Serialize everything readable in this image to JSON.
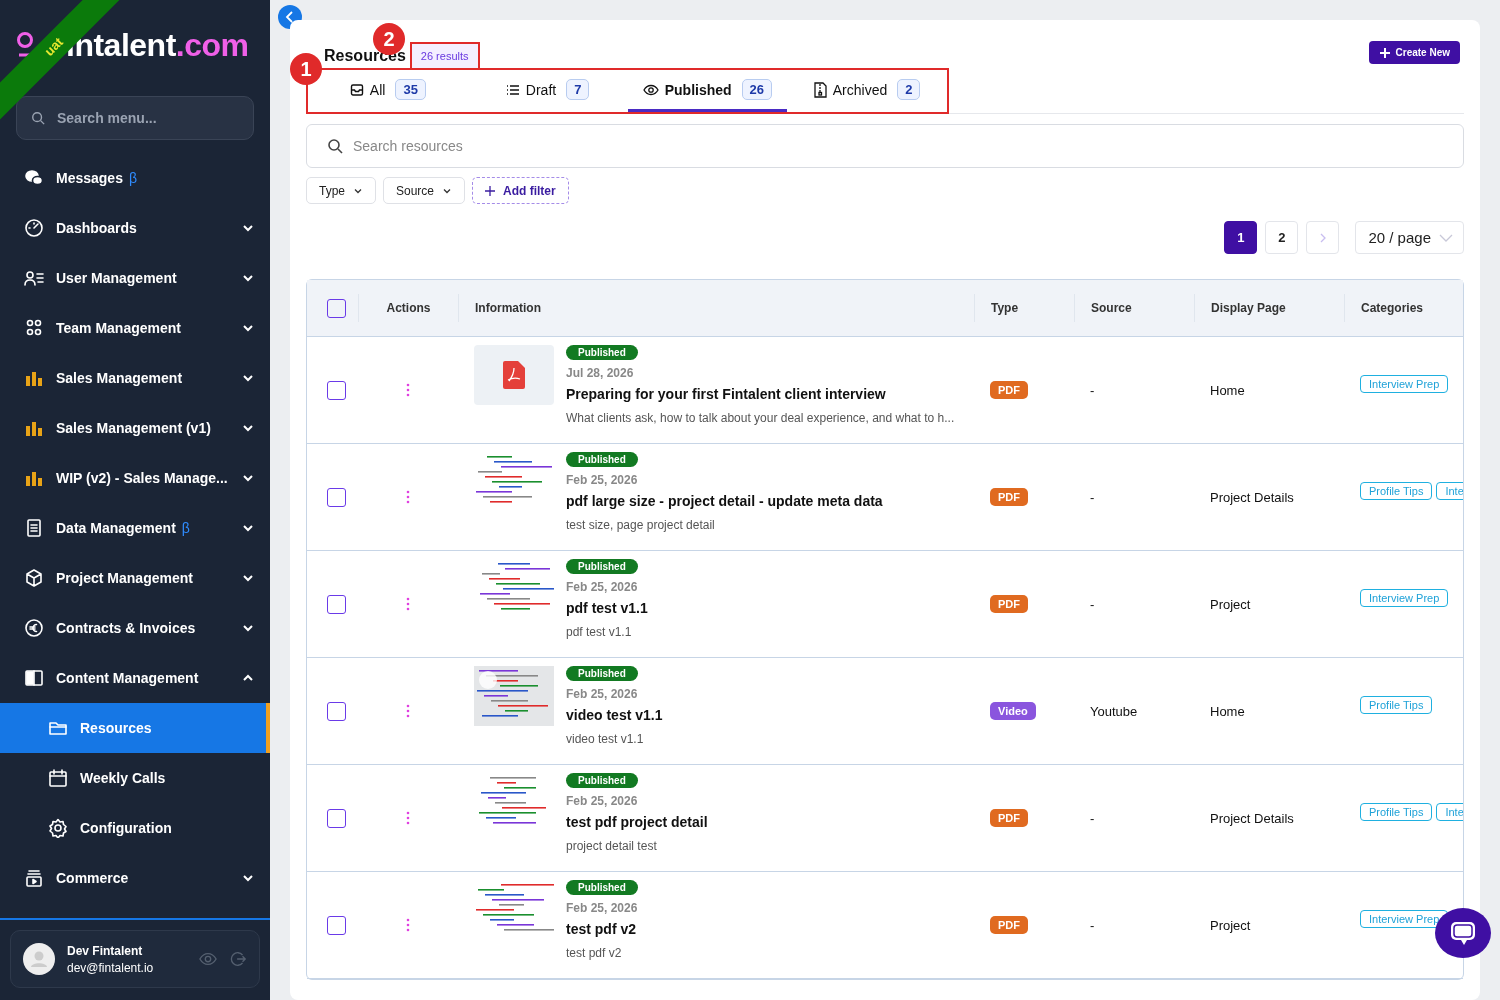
{
  "ribbon": {
    "label": "uat"
  },
  "sidebar": {
    "logo": {
      "name": "intalent",
      "suffix": ".com"
    },
    "search": {
      "placeholder": "Search menu..."
    },
    "items": [
      {
        "label": "Messages",
        "badge": "β"
      },
      {
        "label": "Dashboards",
        "expanded": false
      },
      {
        "label": "User Management",
        "expanded": false
      },
      {
        "label": "Team Management",
        "expanded": false
      },
      {
        "label": "Sales Management",
        "expanded": false
      },
      {
        "label": "Sales Management (v1)",
        "expanded": false
      },
      {
        "label": "WIP (v2) - Sales Manage...",
        "expanded": false
      },
      {
        "label": "Data Management",
        "badge": "β",
        "expanded": false
      },
      {
        "label": "Project Management",
        "expanded": false
      },
      {
        "label": "Contracts & Invoices",
        "expanded": false
      },
      {
        "label": "Content Management",
        "expanded": true,
        "children": [
          {
            "label": "Resources",
            "selected": true
          },
          {
            "label": "Weekly Calls",
            "selected": false
          },
          {
            "label": "Configuration",
            "selected": false
          }
        ]
      },
      {
        "label": "Commerce",
        "expanded": false
      }
    ],
    "user": {
      "name": "Dev Fintalent",
      "email": "dev@fintalent.io"
    }
  },
  "page": {
    "title": "Resources",
    "result_count": "26 results",
    "create_button": "Create New",
    "tabs": [
      {
        "label": "All",
        "count": "35",
        "selected": false
      },
      {
        "label": "Draft",
        "count": "7",
        "selected": false
      },
      {
        "label": "Published",
        "count": "26",
        "selected": true
      },
      {
        "label": "Archived",
        "count": "2",
        "selected": false
      }
    ],
    "search": {
      "placeholder": "Search resources"
    },
    "filters": [
      {
        "label": "Type",
        "kind": "dropdown"
      },
      {
        "label": "Source",
        "kind": "dropdown"
      },
      {
        "label": "Add filter",
        "kind": "add"
      }
    ],
    "pagination": {
      "pages": [
        {
          "label": "1",
          "selected": true
        },
        {
          "label": "2",
          "selected": false
        }
      ],
      "next_disabled": true,
      "page_size": "20 / page"
    },
    "table": {
      "columns": [
        "Actions",
        "Information",
        "Type",
        "Source",
        "Display Page",
        "Categories"
      ],
      "header_checked": false,
      "rows": [
        {
          "checked": false,
          "kind": "pdf",
          "preview": false,
          "status": "Published",
          "date": "Jul 28, 2026",
          "title": "Preparing for your first Fintalent client interview",
          "description": "What clients ask, how to talk about your deal experience, and what to h...",
          "type": "PDF",
          "source": "-",
          "display_page": "Home",
          "categories": [
            "Interview Prep"
          ]
        },
        {
          "checked": false,
          "kind": "pdf",
          "preview": true,
          "status": "Published",
          "date": "Feb 25, 2026",
          "title": "pdf large size - project detail - update meta data",
          "description": "test size, page project detail",
          "type": "PDF",
          "source": "-",
          "display_page": "Project Details",
          "categories": [
            "Profile Tips",
            "Inte"
          ]
        },
        {
          "checked": false,
          "kind": "pdf",
          "preview": true,
          "status": "Published",
          "date": "Feb 25, 2026",
          "title": "pdf test v1.1",
          "description": "pdf test v1.1",
          "type": "PDF",
          "source": "-",
          "display_page": "Project",
          "categories": [
            "Interview Prep"
          ]
        },
        {
          "checked": false,
          "kind": "video",
          "preview": true,
          "status": "Published",
          "date": "Feb 25, 2026",
          "title": "video test v1.1",
          "description": "video test v1.1",
          "type": "Video",
          "source": "Youtube",
          "display_page": "Home",
          "categories": [
            "Profile Tips"
          ]
        },
        {
          "checked": false,
          "kind": "pdf",
          "preview": true,
          "status": "Published",
          "date": "Feb 25, 2026",
          "title": "test pdf project detail",
          "description": "project detail test",
          "type": "PDF",
          "source": "-",
          "display_page": "Project Details",
          "categories": [
            "Profile Tips",
            "Inte"
          ]
        },
        {
          "checked": false,
          "kind": "pdf",
          "preview": true,
          "status": "Published",
          "date": "Feb 25, 2026",
          "title": "test pdf v2",
          "description": "test pdf v2",
          "type": "PDF",
          "source": "-",
          "display_page": "Project",
          "categories": [
            "Interview Prep"
          ]
        }
      ]
    }
  },
  "annotations": [
    {
      "label": "1"
    },
    {
      "label": "2"
    }
  ]
}
